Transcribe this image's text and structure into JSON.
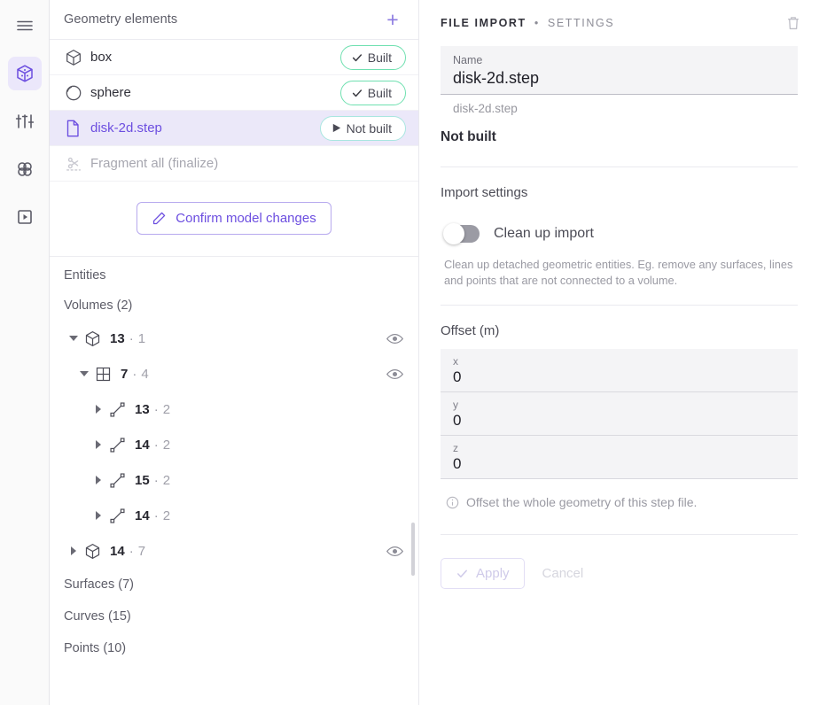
{
  "rail": {
    "items": [
      {
        "name": "menu-icon",
        "label": "Menu",
        "active": false
      },
      {
        "name": "geometry-icon",
        "label": "Geometry",
        "active": true
      },
      {
        "name": "sliders-icon",
        "label": "Settings",
        "active": false
      },
      {
        "name": "mesh-icon",
        "label": "Mesh",
        "active": false
      },
      {
        "name": "run-icon",
        "label": "Run",
        "active": false
      }
    ]
  },
  "geometry_panel": {
    "title": "Geometry elements",
    "add_label": "+",
    "elements": [
      {
        "label": "box",
        "icon": "cube-icon",
        "status": "Built",
        "status_type": "built",
        "selected": false,
        "muted": false
      },
      {
        "label": "sphere",
        "icon": "sphere-icon",
        "status": "Built",
        "status_type": "built",
        "selected": false,
        "muted": false
      },
      {
        "label": "disk-2d.step",
        "icon": "file-icon",
        "status": "Not built",
        "status_type": "notbuilt",
        "selected": true,
        "muted": false
      },
      {
        "label": "Fragment all (finalize)",
        "icon": "fragment-icon",
        "status": "",
        "status_type": "none",
        "selected": false,
        "muted": true
      }
    ],
    "confirm_label": "Confirm model changes"
  },
  "entities": {
    "heading": "Entities",
    "volumes_heading": "Volumes (2)",
    "tree": [
      {
        "indent": 0,
        "caret": "down",
        "icon": "cube-icon",
        "id": "13",
        "count": "1",
        "eye": true,
        "sep": "·"
      },
      {
        "indent": 1,
        "caret": "down",
        "icon": "surface-icon",
        "id": "7",
        "count": "4",
        "eye": true,
        "sep": "·"
      },
      {
        "indent": 2,
        "caret": "right",
        "icon": "curve-icon",
        "id": "13",
        "count": "2",
        "eye": false,
        "sep": "·"
      },
      {
        "indent": 2,
        "caret": "right",
        "icon": "curve-icon",
        "id": "14",
        "count": "2",
        "eye": false,
        "sep": "·"
      },
      {
        "indent": 2,
        "caret": "right",
        "icon": "curve-icon",
        "id": "15",
        "count": "2",
        "eye": false,
        "sep": "·"
      },
      {
        "indent": 2,
        "caret": "right",
        "icon": "curve-icon",
        "id": "14",
        "count": "2",
        "eye": false,
        "sep": "·"
      },
      {
        "indent": 0,
        "caret": "right",
        "icon": "cube-icon",
        "id": "14",
        "count": "7",
        "eye": true,
        "sep": "·"
      }
    ],
    "groups": [
      {
        "label": "Surfaces (7)"
      },
      {
        "label": "Curves (15)"
      },
      {
        "label": "Points (10)"
      }
    ]
  },
  "settings_panel": {
    "header_primary": "FILE IMPORT",
    "header_sep": "•",
    "header_secondary": "SETTINGS",
    "delete_icon": "trash-icon",
    "name_label": "Name",
    "name_value": "disk-2d.step",
    "file_name": "disk-2d.step",
    "build_status": "Not built",
    "import_settings_title": "Import settings",
    "cleanup_toggle_label": "Clean up import",
    "cleanup_toggle_on": false,
    "cleanup_helper": "Clean up detached geometric entities. Eg. remove any surfaces, lines and points that are not connected to a volume.",
    "offset_title": "Offset (m)",
    "offset_fields": [
      {
        "label": "x",
        "value": "0"
      },
      {
        "label": "y",
        "value": "0"
      },
      {
        "label": "z",
        "value": "0"
      }
    ],
    "offset_helper": "Offset the whole geometry of this step file.",
    "apply_label": "Apply",
    "cancel_label": "Cancel"
  },
  "colors": {
    "accent": "#6c4ee0",
    "accent_soft": "#ebe8f9",
    "built_border": "#6fe0b0",
    "notbuilt_border": "#a8e6e0",
    "muted_text": "#a7a7b0"
  }
}
